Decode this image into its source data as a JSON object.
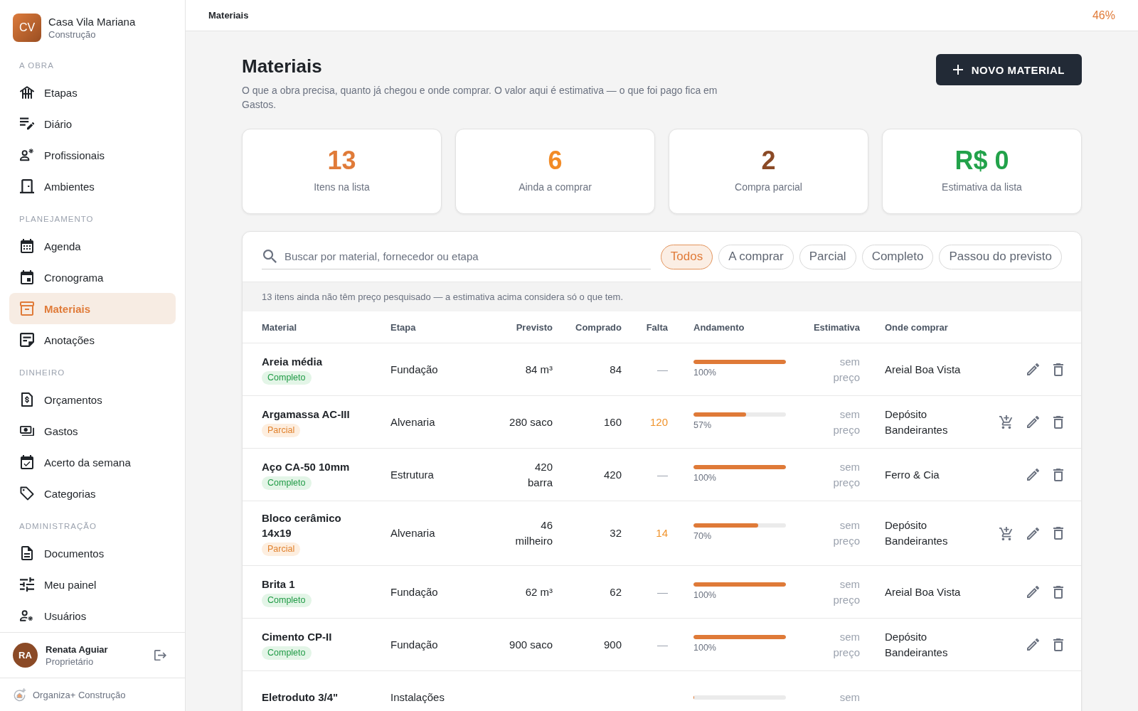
{
  "sidebar": {
    "brand": {
      "initials": "CV",
      "name": "Casa Vila Mariana",
      "subtitle": "Construção"
    },
    "sections": [
      {
        "label": "A OBRA",
        "items": [
          {
            "label": "Etapas",
            "selected": false
          },
          {
            "label": "Diário",
            "selected": false
          },
          {
            "label": "Profissionais",
            "selected": false
          },
          {
            "label": "Ambientes",
            "selected": false
          }
        ]
      },
      {
        "label": "PLANEJAMENTO",
        "items": [
          {
            "label": "Agenda",
            "selected": false
          },
          {
            "label": "Cronograma",
            "selected": false
          },
          {
            "label": "Materiais",
            "selected": true
          },
          {
            "label": "Anotações",
            "selected": false
          }
        ]
      },
      {
        "label": "DINHEIRO",
        "items": [
          {
            "label": "Orçamentos",
            "selected": false
          },
          {
            "label": "Gastos",
            "selected": false
          },
          {
            "label": "Acerto da semana",
            "selected": false
          },
          {
            "label": "Categorias",
            "selected": false
          }
        ]
      },
      {
        "label": "ADMINISTRAÇÃO",
        "items": [
          {
            "label": "Documentos",
            "selected": false
          },
          {
            "label": "Meu painel",
            "selected": false
          },
          {
            "label": "Usuários",
            "selected": false
          }
        ]
      }
    ],
    "user": {
      "initials": "RA",
      "name": "Renata Aguiar",
      "role": "Proprietário"
    },
    "footer": "Organiza+ Construção"
  },
  "topbar": {
    "title": "Materiais",
    "progress": "46%"
  },
  "page": {
    "title": "Materiais",
    "description": "O que a obra precisa, quanto já chegou e onde comprar. O valor aqui é estimativa — o que foi pago fica em Gastos.",
    "new_button": "NOVO MATERIAL"
  },
  "stats": [
    {
      "value": "13",
      "label": "Itens na lista",
      "color": "#e07b39"
    },
    {
      "value": "6",
      "label": "Ainda a comprar",
      "color": "#f28b26"
    },
    {
      "value": "2",
      "label": "Compra parcial",
      "color": "#8b4a26"
    },
    {
      "value": "R$ 0",
      "label": "Estimativa da lista",
      "color": "#22a24a"
    }
  ],
  "search": {
    "placeholder": "Buscar por material, fornecedor ou etapa"
  },
  "filters": [
    {
      "label": "Todos",
      "selected": true
    },
    {
      "label": "A comprar",
      "selected": false
    },
    {
      "label": "Parcial",
      "selected": false
    },
    {
      "label": "Completo",
      "selected": false
    },
    {
      "label": "Passou do previsto",
      "selected": false
    }
  ],
  "notice": "13 itens ainda não têm preço pesquisado — a estimativa acima considera só o que tem.",
  "table": {
    "columns": [
      "Material",
      "Etapa",
      "Previsto",
      "Comprado",
      "Falta",
      "Andamento",
      "Estimativa",
      "Onde comprar"
    ],
    "rows": [
      {
        "material": "Areia média",
        "status": {
          "label": "Completo",
          "kind": "complete"
        },
        "stage": "Fundação",
        "planned": "84 m³",
        "bought": "84",
        "missing": "—",
        "level": 1,
        "percent": "100%",
        "estimate": "sem preço",
        "supplier": "Areial Boa Vista",
        "buy_button": false,
        "edit_button": true,
        "delete_button": true
      },
      {
        "material": "Argamassa AC-III",
        "status": {
          "label": "Parcial",
          "kind": "partial"
        },
        "stage": "Alvenaria",
        "planned": "280 saco",
        "bought": "160",
        "missing": "120",
        "level": 0.57,
        "percent": "57%",
        "estimate": "sem preço",
        "supplier": "Depósito Bandeirantes",
        "buy_button": true,
        "edit_button": true,
        "delete_button": true
      },
      {
        "material": "Aço CA-50 10mm",
        "status": {
          "label": "Completo",
          "kind": "complete"
        },
        "stage": "Estrutura",
        "planned": "420 barra",
        "bought": "420",
        "missing": "—",
        "level": 1,
        "percent": "100%",
        "estimate": "sem preço",
        "supplier": "Ferro & Cia",
        "buy_button": false,
        "edit_button": true,
        "delete_button": true
      },
      {
        "material": "Bloco cerâmico 14x19",
        "status": {
          "label": "Parcial",
          "kind": "partial"
        },
        "stage": "Alvenaria",
        "planned": "46 milheiro",
        "bought": "32",
        "missing": "14",
        "level": 0.7,
        "percent": "70%",
        "estimate": "sem preço",
        "supplier": "Depósito Bandeirantes",
        "buy_button": true,
        "edit_button": true,
        "delete_button": true
      },
      {
        "material": "Brita 1",
        "status": {
          "label": "Completo",
          "kind": "complete"
        },
        "stage": "Fundação",
        "planned": "62 m³",
        "bought": "62",
        "missing": "—",
        "level": 1,
        "percent": "100%",
        "estimate": "sem preço",
        "supplier": "Areial Boa Vista",
        "buy_button": false,
        "edit_button": true,
        "delete_button": true
      },
      {
        "material": "Cimento CP-II",
        "status": {
          "label": "Completo",
          "kind": "complete"
        },
        "stage": "Fundação",
        "planned": "900 saco",
        "bought": "900",
        "missing": "—",
        "level": 1,
        "percent": "100%",
        "estimate": "sem preço",
        "supplier": "Depósito Bandeirantes",
        "buy_button": false,
        "edit_button": true,
        "delete_button": true
      },
      {
        "material": "Eletroduto 3/4\"",
        "stage": "Instalações",
        "level": 0,
        "estimate": "sem",
        "buy_button": false,
        "edit_button": false,
        "delete_button": false
      }
    ]
  }
}
